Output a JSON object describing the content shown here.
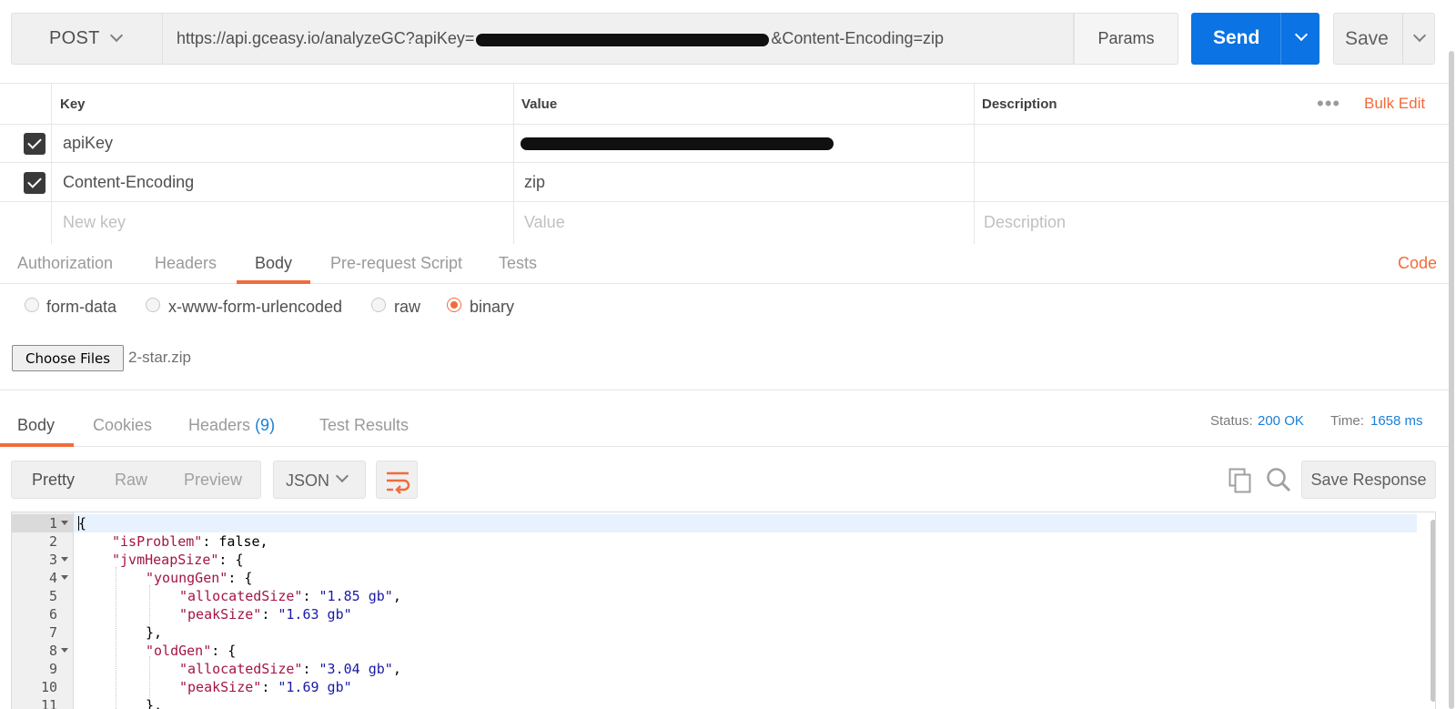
{
  "request": {
    "method": "POST",
    "url_prefix": "https://api.gceasy.io/analyzeGC?apiKey=",
    "url_suffix": "&Content-Encoding=zip",
    "params_label": "Params",
    "send_label": "Send",
    "save_label": "Save"
  },
  "params_table": {
    "headers": {
      "key": "Key",
      "value": "Value",
      "description": "Description"
    },
    "bulk_edit": "Bulk Edit",
    "rows": [
      {
        "key": "apiKey",
        "value": "",
        "description": "",
        "checked": true
      },
      {
        "key": "Content-Encoding",
        "value": "zip",
        "description": "",
        "checked": true
      }
    ],
    "new_row": {
      "key": "New key",
      "value": "Value",
      "description": "Description"
    }
  },
  "request_tabs": {
    "items": [
      "Authorization",
      "Headers",
      "Body",
      "Pre-request Script",
      "Tests"
    ],
    "active": "Body",
    "code_label": "Code"
  },
  "body_types": {
    "options": [
      "form-data",
      "x-www-form-urlencoded",
      "raw",
      "binary"
    ],
    "selected": "binary"
  },
  "file_input": {
    "button_label": "Choose Files",
    "file_name": "2-star.zip"
  },
  "response_tabs": {
    "items": [
      "Body",
      "Cookies",
      "Headers",
      "Test Results"
    ],
    "headers_count": "(9)",
    "active": "Body"
  },
  "response_status": {
    "status_label": "Status:",
    "status_value": "200 OK",
    "time_label": "Time:",
    "time_value": "1658 ms"
  },
  "response_toolbar": {
    "views": [
      "Pretty",
      "Raw",
      "Preview"
    ],
    "active_view": "Pretty",
    "format": "JSON",
    "save_response": "Save Response"
  },
  "code_lines": [
    {
      "n": "1",
      "fold": true
    },
    {
      "n": "2",
      "fold": false
    },
    {
      "n": "3",
      "fold": true
    },
    {
      "n": "4",
      "fold": true
    },
    {
      "n": "5",
      "fold": false
    },
    {
      "n": "6",
      "fold": false
    },
    {
      "n": "7",
      "fold": false
    },
    {
      "n": "8",
      "fold": true
    },
    {
      "n": "9",
      "fold": false
    },
    {
      "n": "10",
      "fold": false
    },
    {
      "n": "11",
      "fold": false
    }
  ],
  "code_text": {
    "l1": "{",
    "is_problem_key": "\"isProblem\"",
    "is_problem_val": ": false,",
    "jvm_heap_key": "\"jvmHeapSize\"",
    "jvm_heap_open": ": {",
    "young_gen_key": "\"youngGen\"",
    "young_gen_open": ": {",
    "young_alloc_key": "\"allocatedSize\"",
    "young_alloc_val": "\"1.85 gb\"",
    "young_peak_key": "\"peakSize\"",
    "young_peak_val": "\"1.63 gb\"",
    "young_close": "},",
    "old_gen_key": "\"oldGen\"",
    "old_gen_open": ": {",
    "old_alloc_key": "\"allocatedSize\"",
    "old_alloc_val": "\"3.04 gb\"",
    "old_peak_key": "\"peakSize\"",
    "old_peak_val": "\"1.69 gb\"",
    "l11": "},"
  },
  "colors": {
    "accent_orange": "#f26b3a",
    "send_blue": "#0b73e3",
    "link_blue": "#1a7fd4"
  },
  "icons": [
    "chevron-down-icon",
    "more-icon",
    "wrap-lines-icon",
    "copy-icon",
    "search-icon"
  ]
}
